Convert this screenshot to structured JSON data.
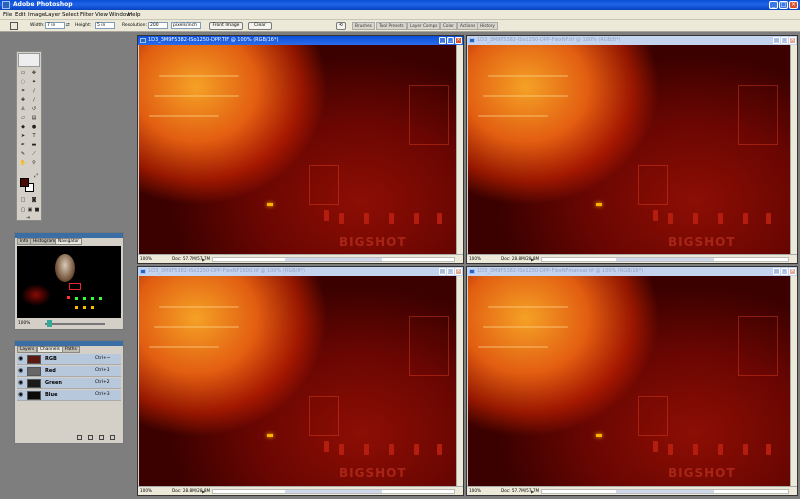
{
  "app": {
    "title": "Adobe Photoshop"
  },
  "window_controls": {
    "minimize": "_",
    "maximize": "□",
    "close": "×"
  },
  "menu": [
    "File",
    "Edit",
    "Image",
    "Layer",
    "Select",
    "Filter",
    "View",
    "Window",
    "Help"
  ],
  "options_bar": {
    "width_label": "Width:",
    "width_value": "7 in",
    "height_label": "Height:",
    "height_value": "5 in",
    "resolution_label": "Resolution:",
    "resolution_value": "200",
    "resolution_unit": "pixels/inch",
    "front_image_button": "Front Image",
    "clear_button": "Clear"
  },
  "palette_well": [
    "Brushes",
    "Tool Presets",
    "Layer Comps",
    "Color",
    "Actions",
    "History"
  ],
  "navigator": {
    "tabs": [
      "Info",
      "Histogram",
      "Navigator"
    ],
    "active_tab": "Navigator",
    "zoom": "100%"
  },
  "channels": {
    "tabs": [
      "Layers",
      "Channels",
      "Paths"
    ],
    "active_tab": "Channels",
    "rows": [
      {
        "name": "RGB",
        "shortcut": "Ctrl+~"
      },
      {
        "name": "Red",
        "shortcut": "Ctrl+1"
      },
      {
        "name": "Green",
        "shortcut": "Ctrl+2"
      },
      {
        "name": "Blue",
        "shortcut": "Ctrl+3"
      }
    ]
  },
  "documents": [
    {
      "title": "1D3_3M9F5382-ISo1250-DPP.TIF @ 100% (RGB/16*)",
      "zoom": "100%",
      "doc_info": "Doc: 57.7M/57.7M",
      "active": true
    },
    {
      "title": "1D3_3M9F5382-ISo1250-DPP-FlexNF.tif @ 100% (RGB/8*)",
      "zoom": "100%",
      "doc_info": "Doc: 28.8M/28.8M",
      "active": false
    },
    {
      "title": "1D3_3M9F5382-ISo1250-DPP-FlexNF1600.tif @ 100% (RGB/8*)",
      "zoom": "100%",
      "doc_info": "Doc: 28.8M/28.8M",
      "active": false
    },
    {
      "title": "1D3_3M9F5382-ISo1250-DPP-FlexNFmanual.tif @ 100% (RGB/16*)",
      "zoom": "100%",
      "doc_info": "Doc: 57.7M/57.7M",
      "active": false
    }
  ],
  "photo": {
    "logo_text": "BIGSHOT"
  },
  "colors": {
    "foreground": "#4a0b05",
    "background": "#ffffff",
    "title_active": "#0a50d8"
  }
}
